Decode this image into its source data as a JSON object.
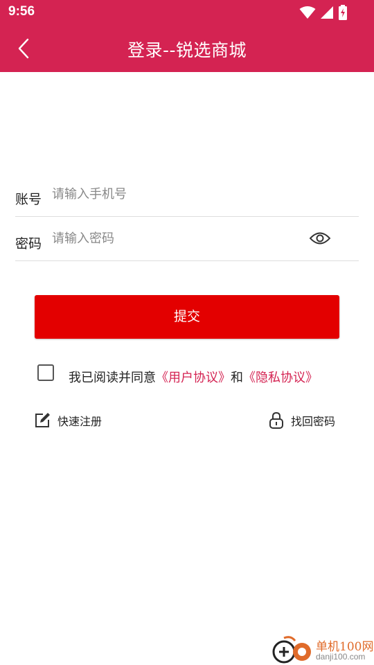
{
  "status_bar": {
    "time": "9:56"
  },
  "app_bar": {
    "title": "登录--锐选商城"
  },
  "form": {
    "account_label": "账号",
    "account_placeholder": "请输入手机号",
    "account_value": "",
    "password_label": "密码",
    "password_placeholder": "请输入密码",
    "password_value": ""
  },
  "submit_label": "提交",
  "agreement": {
    "checked": false,
    "prefix": "我已阅读并同意",
    "user_agreement": "《用户协议》",
    "conjunction": "和",
    "privacy_agreement": "《隐私协议》"
  },
  "links": {
    "quick_register": "快速注册",
    "find_password": "找回密码"
  },
  "watermark": {
    "name": "单机100网",
    "url": "danji100.com"
  },
  "colors": {
    "brand": "#d42352",
    "submit": "#e30000",
    "link": "#d42352"
  }
}
